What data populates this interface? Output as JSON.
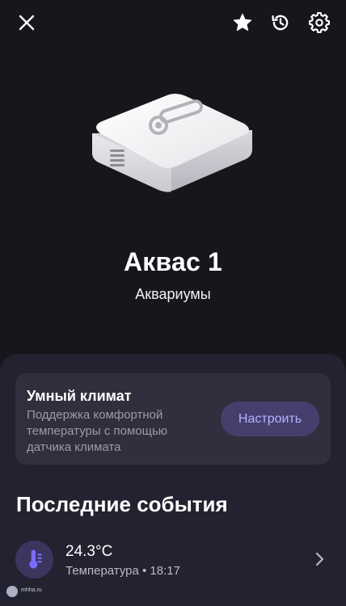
{
  "header": {
    "icons": [
      "close-icon",
      "star-icon",
      "history-icon",
      "gear-icon"
    ]
  },
  "device": {
    "name": "Аквас 1",
    "room": "Аквариумы"
  },
  "climate_card": {
    "title": "Умный климат",
    "description": "Поддержка комфортной температуры с помощью датчика климата",
    "button_label": "Настроить"
  },
  "events": {
    "title": "Последние события",
    "items": [
      {
        "value": "24.3°C",
        "meta": "Температура • 18:17",
        "icon": "thermometer-icon"
      }
    ]
  },
  "watermark": {
    "text": "mhha.ru"
  },
  "colors": {
    "background": "#16161c",
    "sheet": "#222230",
    "card": "#2f2f3d",
    "accent_button_bg": "#453f6e",
    "accent_text": "#b9b0ff",
    "secondary_text": "#9c9ca8"
  }
}
